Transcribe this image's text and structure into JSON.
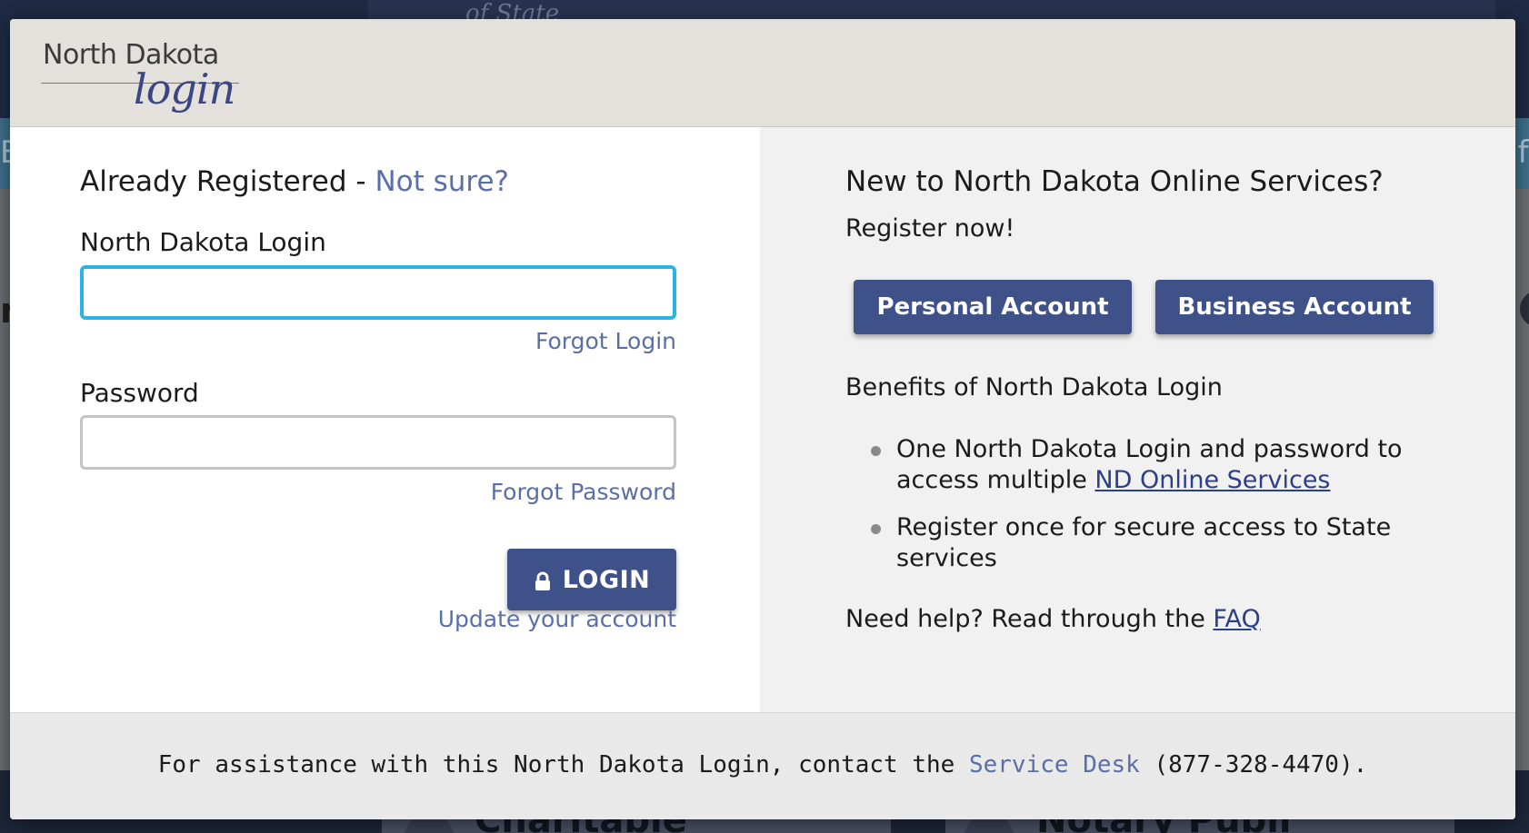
{
  "background": {
    "seal_text": "of State",
    "nav_left_fragment": "E",
    "nav_right_fragment": "if",
    "content_fragment": "n",
    "card_texts": [
      "Charitable",
      "Notary Publi"
    ]
  },
  "header": {
    "logo_line1": "North Dakota",
    "logo_line2": "login"
  },
  "login_form": {
    "heading": "Already Registered - ",
    "heading_link": "Not sure?",
    "login_label": "North Dakota Login",
    "login_value": "",
    "forgot_login": "Forgot Login",
    "password_label": "Password",
    "password_value": "",
    "forgot_password": "Forgot Password",
    "login_button": "LOGIN",
    "update_account": "Update your account"
  },
  "register": {
    "heading": "New to North Dakota Online Services?",
    "subheading": "Register now!",
    "personal_button": "Personal Account",
    "business_button": "Business Account",
    "benefits_title": "Benefits of North Dakota Login",
    "benefits": [
      {
        "text": "One North Dakota Login and password to access multiple ",
        "link": "ND Online Services"
      },
      {
        "text": "Register once for secure access to State services",
        "link": ""
      }
    ],
    "help_text": "Need help? Read through the ",
    "help_link": "FAQ"
  },
  "footer": {
    "text_before": "For assistance with this North Dakota Login, contact the ",
    "link": "Service Desk",
    "text_after": " (877-328-4470)."
  },
  "colors": {
    "accent_button": "#3f5189",
    "link": "#5a6fa6",
    "focus_border": "#2bb3e6",
    "header_bg": "#e4e0db"
  }
}
